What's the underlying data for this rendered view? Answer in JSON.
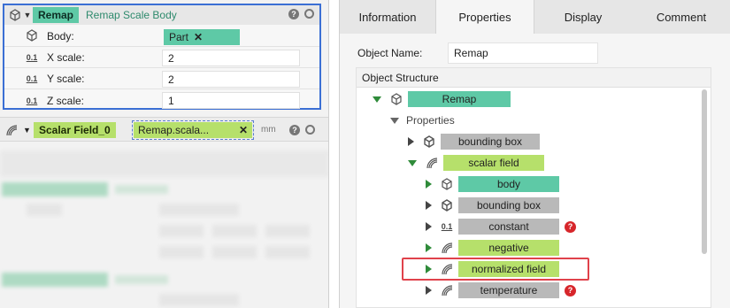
{
  "left": {
    "remap": {
      "title": "Remap",
      "subtitle": "Remap Scale Body",
      "help": "?",
      "rows": [
        {
          "icon": "body-icon",
          "label": "Body:",
          "value": "Part"
        },
        {
          "icon": "0.1",
          "label": "X scale:",
          "value": "2"
        },
        {
          "icon": "0.1",
          "label": "Y scale:",
          "value": "2"
        },
        {
          "icon": "0.1",
          "label": "Z scale:",
          "value": "1"
        }
      ],
      "chip_close": "✕"
    },
    "scalar_field": {
      "title": "Scalar Field_0",
      "chip": "Remap.scala...",
      "chip_close": "✕",
      "unit": "mm",
      "help": "?"
    }
  },
  "right": {
    "tabs": [
      "Information",
      "Properties",
      "Display",
      "Comment"
    ],
    "active_tab": "Properties",
    "object_name_label": "Object Name:",
    "object_name_value": "Remap",
    "structure_header": "Object Structure",
    "tree": {
      "root": "Remap",
      "properties": "Properties",
      "bounding_box_1": "bounding box",
      "scalar_field": "scalar field",
      "body": "body",
      "bounding_box_2": "bounding box",
      "constant": "constant",
      "negative": "negative",
      "normalized_field": "normalized field",
      "temperature": "temperature",
      "help_mark": "?"
    }
  },
  "colors": {
    "teal": "#5ec9a6",
    "lime": "#b6e06b",
    "selection_blue": "#3b6fd4",
    "highlight_red": "#e0424b",
    "error_red": "#d7262b"
  }
}
